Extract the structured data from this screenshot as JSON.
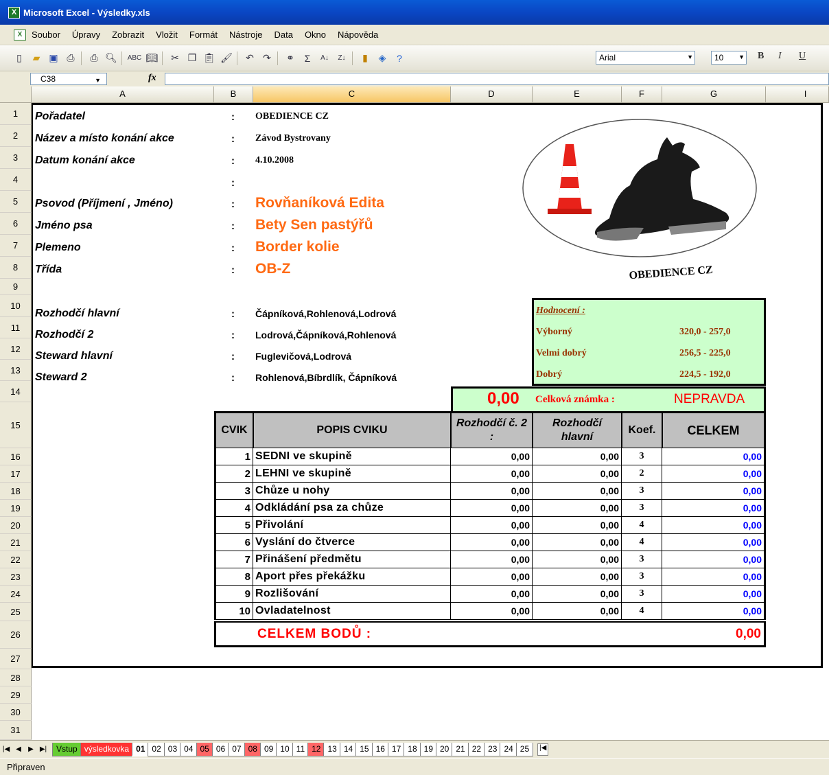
{
  "window": {
    "title": "Microsoft Excel - Výsledky.xls"
  },
  "menu": [
    "Soubor",
    "Úpravy",
    "Zobrazit",
    "Vložit",
    "Formát",
    "Nástroje",
    "Data",
    "Okno",
    "Nápověda"
  ],
  "toolbar": {
    "font": "Arial",
    "size": "10",
    "bold": "B",
    "italic": "I",
    "underline": "U"
  },
  "formula_bar": {
    "cell_ref": "C38",
    "fx": "fx",
    "formula": ""
  },
  "columns": [
    "A",
    "B",
    "C",
    "D",
    "E",
    "F",
    "G",
    "I"
  ],
  "rows": [
    "1",
    "2",
    "3",
    "4",
    "5",
    "6",
    "7",
    "8",
    "9",
    "10",
    "11",
    "12",
    "13",
    "14",
    "15",
    "16",
    "17",
    "18",
    "19",
    "20",
    "21",
    "22",
    "23",
    "24",
    "25",
    "26",
    "27",
    "28",
    "29",
    "30",
    "31"
  ],
  "header_info": {
    "poradatel_label": "Pořadatel",
    "poradatel": "OBEDIENCE CZ",
    "nazev_label": "Název a místo konání akce",
    "nazev": "Závod Bystrovany",
    "datum_label": "Datum konání akce",
    "datum": "4.10.2008",
    "psovod_label": "Psovod (Příjmení , Jméno)",
    "psovod": "Rovňaníková Edita",
    "pes_label": "Jméno psa",
    "pes": "Bety Sen pastýřů",
    "plemeno_label": "Plemeno",
    "plemeno": "Border kolie",
    "trida_label": "Třída",
    "trida": "OB-Z",
    "rozhodci_hlavni_label": "Rozhodčí hlavní",
    "rozhodci_hlavni": "Čápníková,Rohlenová,Lodrová",
    "rozhodci_2_label": "Rozhodčí 2",
    "rozhodci_2": "Lodrová,Čápníková,Rohlenová",
    "steward_hlavni_label": "Steward hlavní",
    "steward_hlavni": "Fuglevičová,Lodrová",
    "steward_2_label": "Steward 2",
    "steward_2": "Rohlenová,Bíbrdlík, Čápníková",
    "colon": ":"
  },
  "logo": {
    "text": "OBEDIENCE CZ"
  },
  "hodnoceni": {
    "title": "Hodnocení :",
    "items": [
      {
        "label": "Výborný",
        "range": "320,0 - 257,0"
      },
      {
        "label": "Velmi dobrý",
        "range": "256,5 - 225,0"
      },
      {
        "label": "Dobrý",
        "range": "224,5 - 192,0"
      }
    ]
  },
  "score": {
    "value": "0,00",
    "label": "Celková známka :",
    "result": "NEPRAVDA"
  },
  "table": {
    "headers": {
      "cvik": "CVIK",
      "popis": "POPIS CVIKU",
      "rozhodci2": "Rozhodčí č. 2 :",
      "hlavni": "Rozhodčí hlavní",
      "koef": "Koef.",
      "celkem": "CELKEM"
    },
    "rows": [
      {
        "n": "1",
        "name": "SEDNI ve skupině",
        "r2": "0,00",
        "rh": "0,00",
        "k": "3",
        "total": "0,00"
      },
      {
        "n": "2",
        "name": "LEHNI ve skupině",
        "r2": "0,00",
        "rh": "0,00",
        "k": "2",
        "total": "0,00"
      },
      {
        "n": "3",
        "name": "Chůze u nohy",
        "r2": "0,00",
        "rh": "0,00",
        "k": "3",
        "total": "0,00"
      },
      {
        "n": "4",
        "name": "Odkládání psa za chůze",
        "r2": "0,00",
        "rh": "0,00",
        "k": "3",
        "total": "0,00"
      },
      {
        "n": "5",
        "name": "Přivolání",
        "r2": "0,00",
        "rh": "0,00",
        "k": "4",
        "total": "0,00"
      },
      {
        "n": "6",
        "name": "Vyslání do čtverce",
        "r2": "0,00",
        "rh": "0,00",
        "k": "4",
        "total": "0,00"
      },
      {
        "n": "7",
        "name": "Přinášení předmětu",
        "r2": "0,00",
        "rh": "0,00",
        "k": "3",
        "total": "0,00"
      },
      {
        "n": "8",
        "name": "Aport přes překážku",
        "r2": "0,00",
        "rh": "0,00",
        "k": "3",
        "total": "0,00"
      },
      {
        "n": "9",
        "name": "Rozlišování",
        "r2": "0,00",
        "rh": "0,00",
        "k": "3",
        "total": "0,00"
      },
      {
        "n": "10",
        "name": "Ovladatelnost",
        "r2": "0,00",
        "rh": "0,00",
        "k": "4",
        "total": "0,00"
      }
    ],
    "total_label": "CELKEM BODŮ :",
    "total_value": "0,00"
  },
  "sheet_tabs": [
    {
      "name": "Vstup",
      "color": "#66cc33"
    },
    {
      "name": "výsledkovka",
      "color": "#ff3333"
    },
    {
      "name": "01",
      "color": "#ffffff",
      "active": true
    },
    {
      "name": "02",
      "color": "#ffffff"
    },
    {
      "name": "03",
      "color": "#ffffff"
    },
    {
      "name": "04",
      "color": "#ffffff"
    },
    {
      "name": "05",
      "color": "#ff6666"
    },
    {
      "name": "06",
      "color": "#ffffff"
    },
    {
      "name": "07",
      "color": "#ffffff"
    },
    {
      "name": "08",
      "color": "#ff6666"
    },
    {
      "name": "09",
      "color": "#ffffff"
    },
    {
      "name": "10",
      "color": "#ffffff"
    },
    {
      "name": "11",
      "color": "#ffffff"
    },
    {
      "name": "12",
      "color": "#ff6666"
    },
    {
      "name": "13",
      "color": "#ffffff"
    },
    {
      "name": "14",
      "color": "#ffffff"
    },
    {
      "name": "15",
      "color": "#ffffff"
    },
    {
      "name": "16",
      "color": "#ffffff"
    },
    {
      "name": "17",
      "color": "#ffffff"
    },
    {
      "name": "18",
      "color": "#ffffff"
    },
    {
      "name": "19",
      "color": "#ffffff"
    },
    {
      "name": "20",
      "color": "#ffffff"
    },
    {
      "name": "21",
      "color": "#ffffff"
    },
    {
      "name": "22",
      "color": "#ffffff"
    },
    {
      "name": "23",
      "color": "#ffffff"
    },
    {
      "name": "24",
      "color": "#ffffff"
    },
    {
      "name": "25",
      "color": "#ffffff"
    }
  ],
  "status": "Připraven",
  "colors": {
    "orange": "#ff6a13",
    "red": "#ff0000",
    "blue": "#0000ff",
    "legend_bg": "#ccffcc",
    "legend_text": "#993300"
  }
}
